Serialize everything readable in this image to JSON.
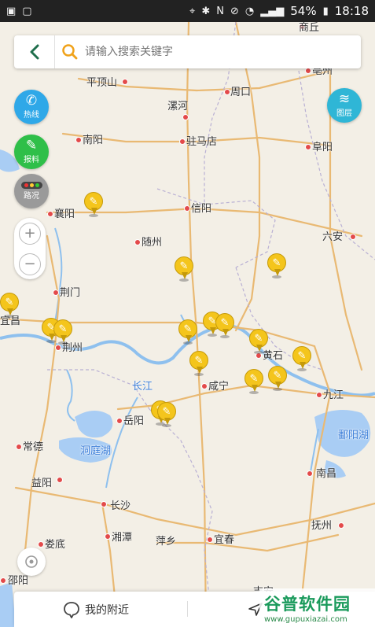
{
  "status_bar": {
    "battery": "54%",
    "time": "18:18"
  },
  "search": {
    "placeholder": "请输入搜索关键字"
  },
  "buttons": {
    "hotline": "热线",
    "report": "报料",
    "traffic": "路况",
    "layer": "图层"
  },
  "zoom": {
    "in": "+",
    "out": "−"
  },
  "bottom": {
    "nearby": "我的附近"
  },
  "watermark": {
    "main": "谷普软件园",
    "sub": "www.gupuxiazai.com"
  },
  "map": {
    "cities": [
      "商丘",
      "亳州",
      "平顶山",
      "周口",
      "漯河",
      "南阳",
      "驻马店",
      "阜阳",
      "信阳",
      "襄阳",
      "随州",
      "六安",
      "荆门",
      "宜昌",
      "荆州",
      "黄石",
      "咸宁",
      "九江",
      "岳阳",
      "常德",
      "鄱阳湖",
      "益阳",
      "南昌",
      "长沙",
      "抚州",
      "娄底",
      "湘潭",
      "萍乡",
      "宜春",
      "邵阳",
      "吉安"
    ],
    "water": [
      "长江",
      "洞庭湖",
      "鄱阳湖"
    ]
  }
}
